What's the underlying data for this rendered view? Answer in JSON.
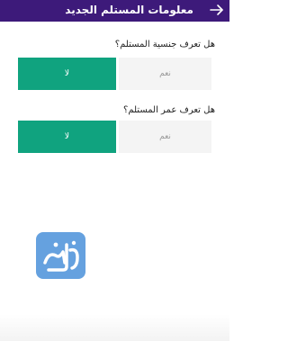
{
  "header": {
    "title": "معلومات المستلم الجديد",
    "back_icon": "arrow-right-icon",
    "background": "#3d1a7a"
  },
  "questions": [
    {
      "label": "هل تعرف جنسية المستلم؟",
      "options": {
        "yes": "نعم",
        "no": "لا"
      },
      "selected": "no"
    },
    {
      "label": "هل تعرف عمر المستلم؟",
      "options": {
        "yes": "نعم",
        "no": "لا"
      },
      "selected": "no"
    }
  ],
  "colors": {
    "selected": "#10a37f",
    "unselected": "#f4f4f4"
  },
  "watermark": {
    "icon": "site-logo-watermark"
  }
}
